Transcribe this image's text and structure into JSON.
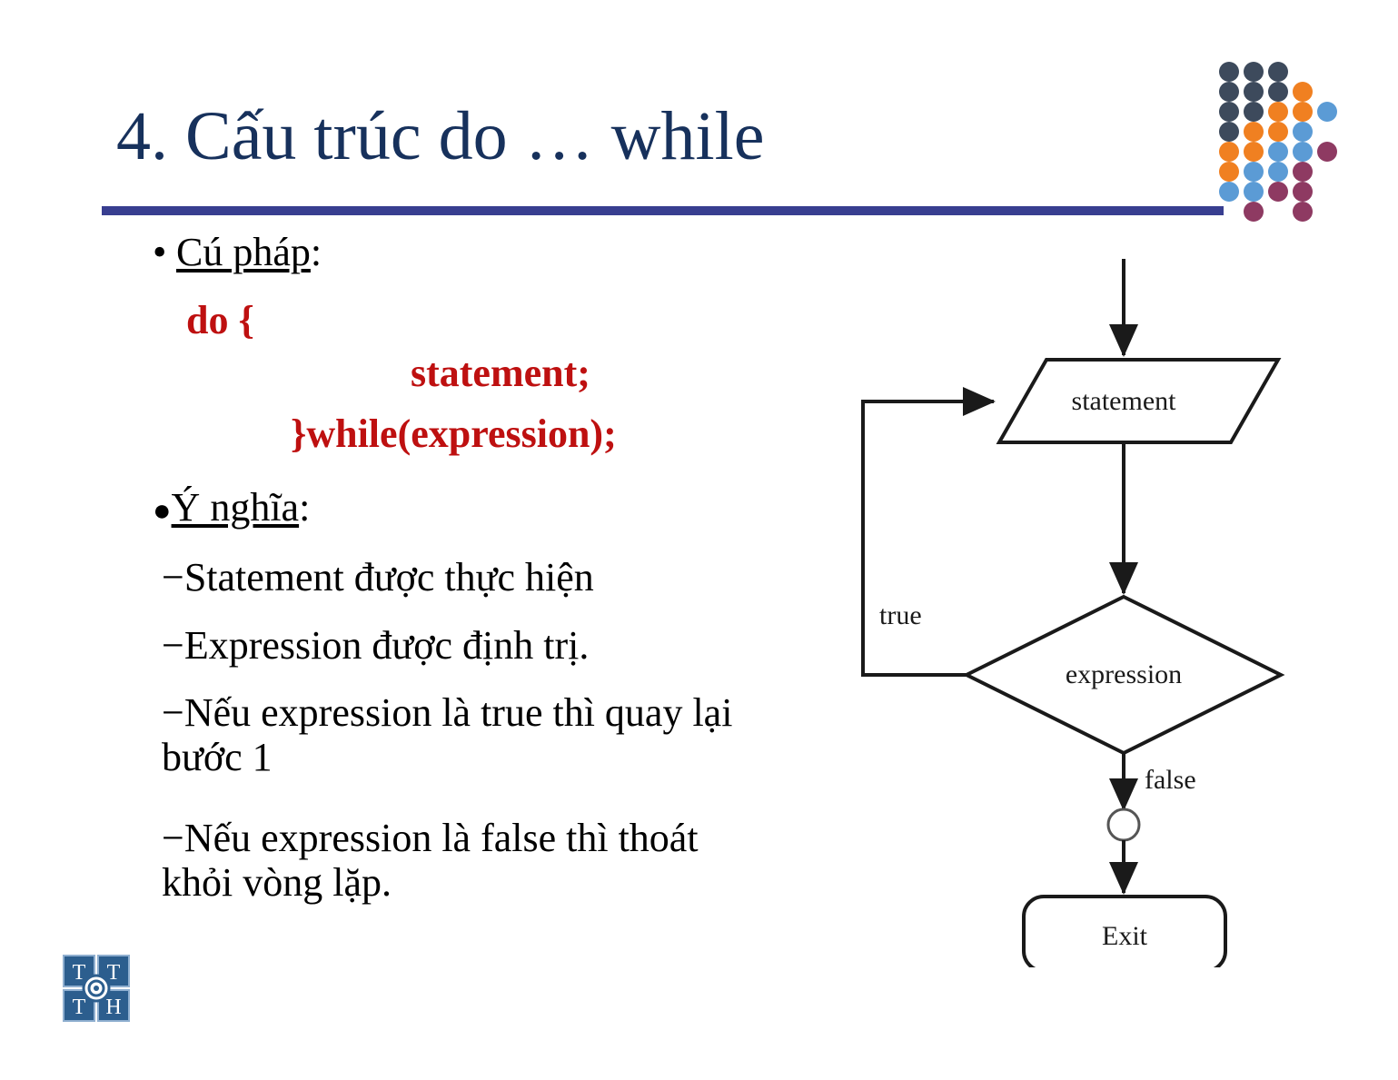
{
  "slide": {
    "title": "4. Cấu trúc do … while",
    "title_color": "#17315C",
    "rule_color": "#383E90",
    "code_color": "#BE1010"
  },
  "content": {
    "syntax_heading": "Cú pháp",
    "syntax_heading_colon": ":",
    "code": {
      "line1": "do {",
      "line2": "statement;",
      "line3": "}while(expression);"
    },
    "meaning_heading": "Ý nghĩa",
    "meaning_heading_colon": ":",
    "bullets": [
      "Statement được thực hiện",
      "Expression được định trị.",
      "Nếu expression là true thì quay lại bước 1",
      "Nếu expression là false thì thoát khỏi vòng lặp."
    ],
    "bullet_marker_dot": "•",
    "bullet_marker_big_dot": "●",
    "bullet_marker_dash": "−"
  },
  "flowchart": {
    "statement_label": "statement",
    "expression_label": "expression",
    "true_label": "true",
    "false_label": "false",
    "exit_label": "Exit"
  },
  "decoration": {
    "dot_colors": {
      "navy": "#3D4A5C",
      "orange": "#F08021",
      "blue": "#5B9BD5",
      "magenta": "#8E3A62"
    },
    "dot_grid": [
      [
        "navy",
        "navy",
        "navy",
        "",
        ""
      ],
      [
        "navy",
        "navy",
        "navy",
        "orange",
        ""
      ],
      [
        "navy",
        "navy",
        "orange",
        "orange",
        "blue"
      ],
      [
        "navy",
        "orange",
        "orange",
        "blue",
        ""
      ],
      [
        "orange",
        "orange",
        "blue",
        "blue",
        "magenta"
      ],
      [
        "orange",
        "blue",
        "blue",
        "magenta",
        ""
      ],
      [
        "blue",
        "blue",
        "magenta",
        "magenta",
        ""
      ],
      [
        "",
        "magenta",
        "",
        "magenta",
        ""
      ]
    ]
  },
  "logo": {
    "letters": [
      "T",
      "T",
      "T",
      "H"
    ],
    "color": "#2C5E8E"
  }
}
